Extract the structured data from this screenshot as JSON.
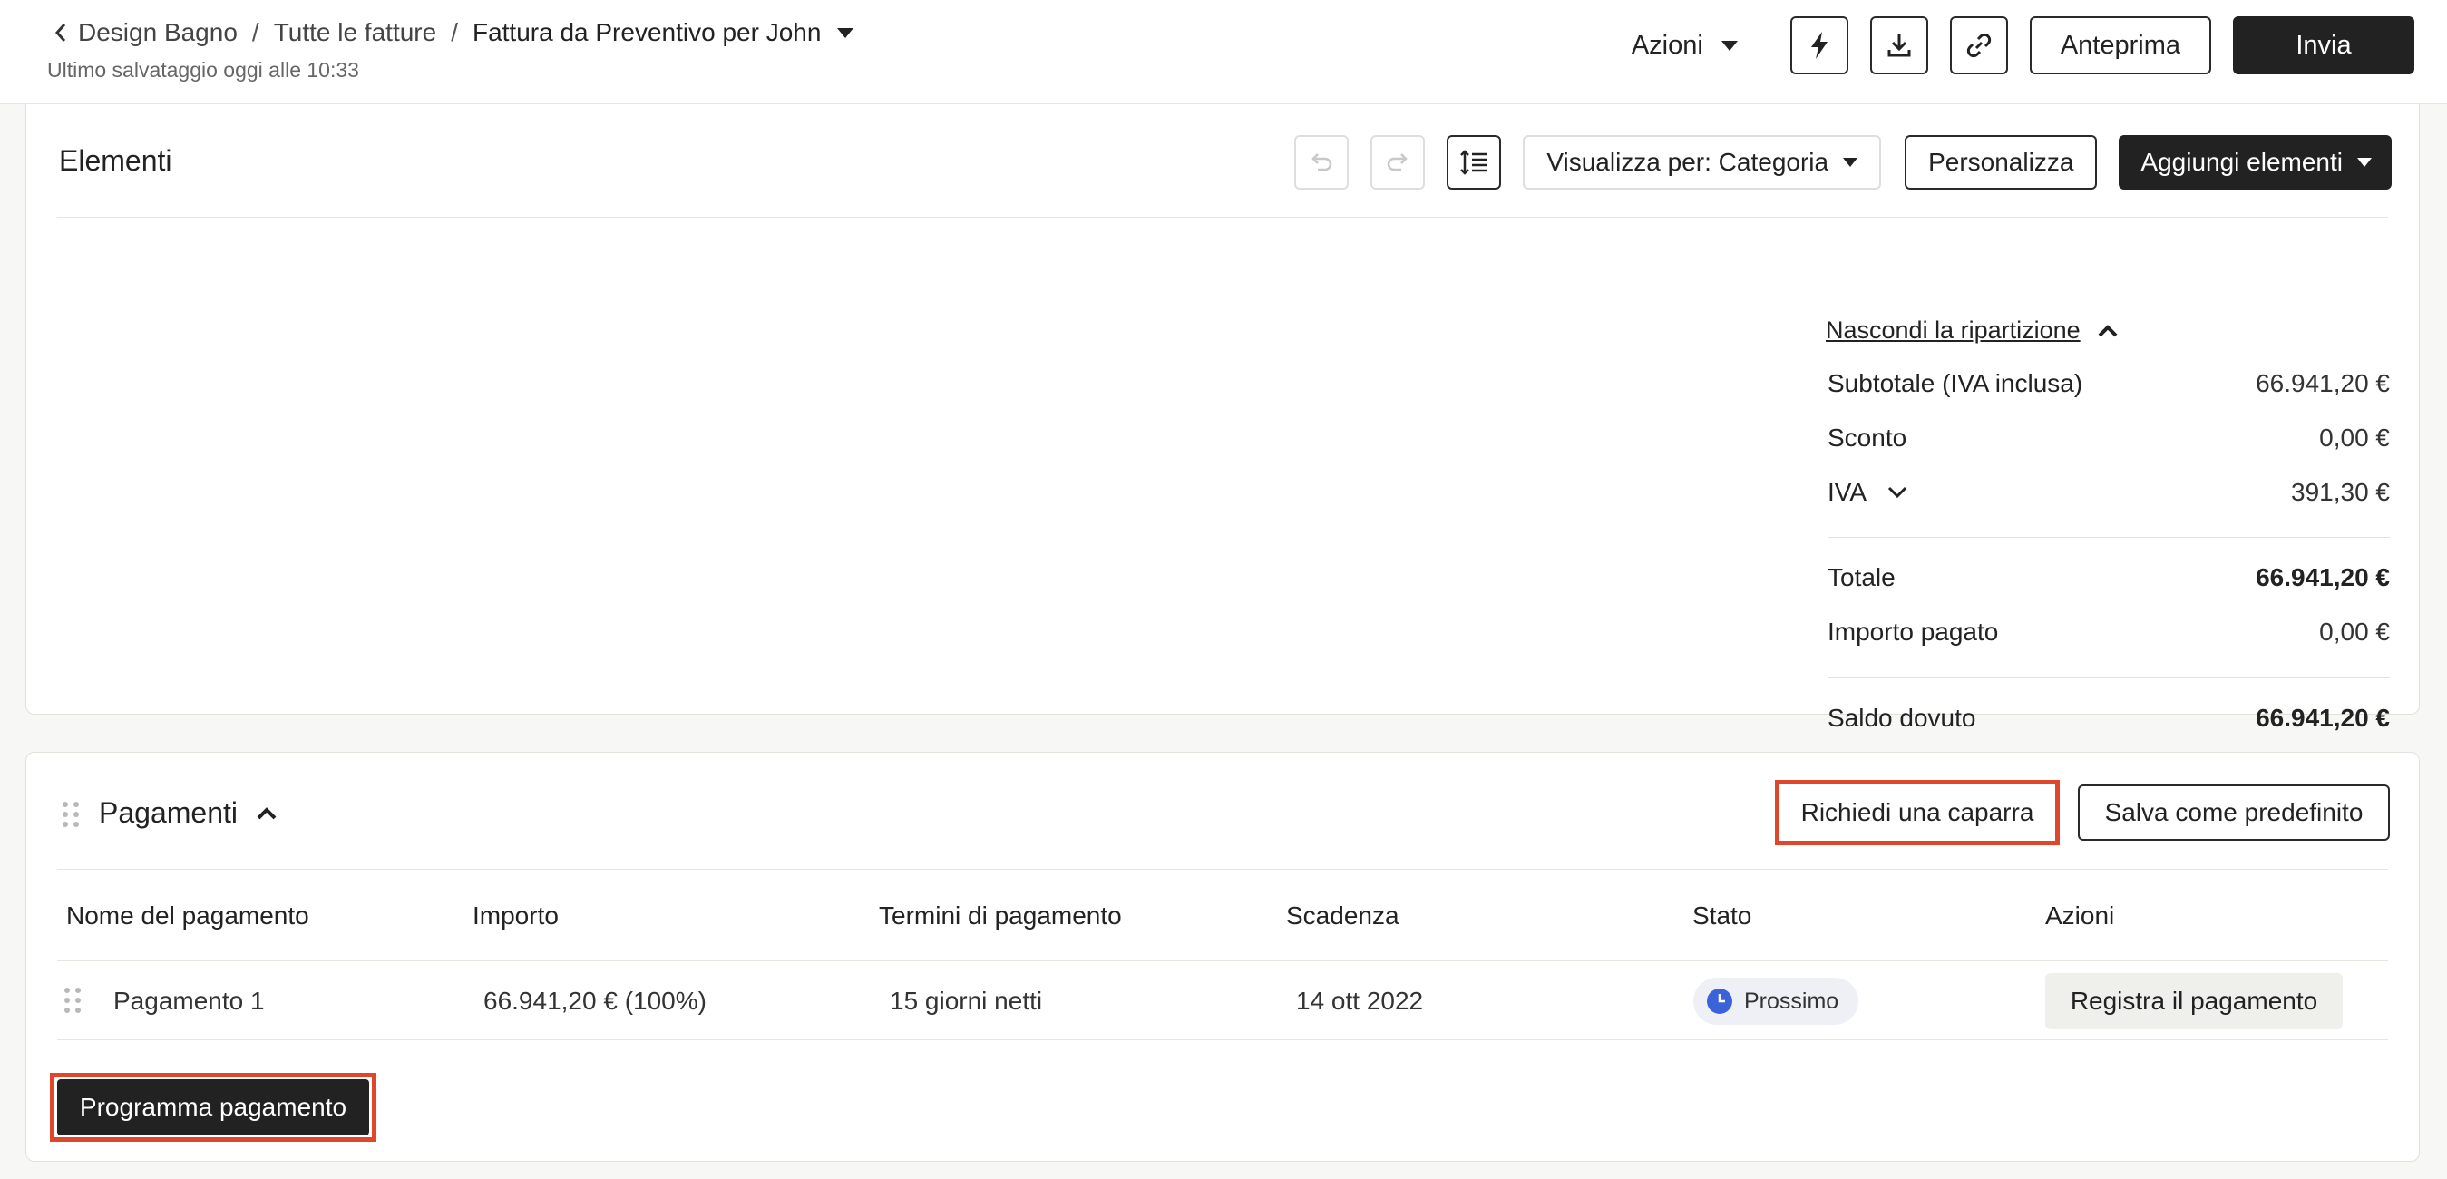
{
  "header": {
    "breadcrumb": {
      "root": "Design Bagno",
      "section": "Tutte le fatture",
      "current": "Fattura da Preventivo per John"
    },
    "last_saved": "Ultimo salvataggio oggi alle 10:33",
    "actions_label": "Azioni",
    "preview_label": "Anteprima",
    "send_label": "Invia"
  },
  "items": {
    "title": "Elementi",
    "view_by": "Visualizza per: Categoria",
    "customize_label": "Personalizza",
    "add_items_label": "Aggiungi elementi",
    "summary": {
      "hide_breakdown": "Nascondi la ripartizione",
      "subtotal_label": "Subtotale (IVA inclusa)",
      "subtotal_value": "66.941,20 €",
      "discount_label": "Sconto",
      "discount_value": "0,00 €",
      "vat_label": "IVA",
      "vat_value": "391,30 €",
      "total_label": "Totale",
      "total_value": "66.941,20 €",
      "paid_label": "Importo pagato",
      "paid_value": "0,00 €",
      "balance_label": "Saldo dovuto",
      "balance_value": "66.941,20 €"
    }
  },
  "payments": {
    "title": "Pagamenti",
    "request_deposit_label": "Richiedi una caparra",
    "save_default_label": "Salva come predefinito",
    "columns": [
      "Nome del pagamento",
      "Importo",
      "Termini di pagamento",
      "Scadenza",
      "Stato",
      "Azioni"
    ],
    "rows": [
      {
        "name": "Pagamento 1",
        "amount": "66.941,20 € (100%)",
        "terms": "15 giorni netti",
        "due": "14 ott 2022",
        "status": "Prossimo",
        "action": "Registra il pagamento"
      }
    ],
    "schedule_label": "Programma pagamento"
  },
  "colors": {
    "highlight": "#e0472a",
    "status_clock": "#3b63d9",
    "dark_button": "#222222"
  }
}
